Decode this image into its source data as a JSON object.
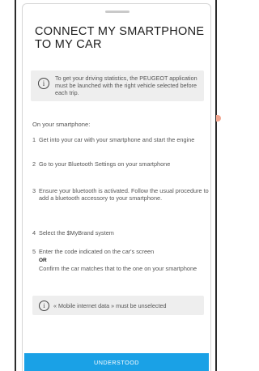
{
  "dialog": {
    "title": "CONNECT MY SMARTPHONE TO MY CAR",
    "info_text": "To get your driving statistics, the PEUGEOT application must be launched with the right vehicle selected before each trip.",
    "info_icon": "info-icon",
    "section_label": "On your smartphone:",
    "steps": [
      {
        "num": "1",
        "text": "Get into your car with your smartphone and start the engine"
      },
      {
        "num": "2",
        "text": "Go to your Bluetooth Settings on your smartphone"
      },
      {
        "num": "3",
        "text": "Ensure your bluetooth is activated. Follow the usual procedure to add a bluetooth accessory to your smartphone."
      },
      {
        "num": "4",
        "text": "Select the $MyBrand system"
      },
      {
        "num": "5",
        "text": "Enter the code indicated on the car's screen",
        "or_label": "OR",
        "alt_text": "Confirm the car matches that to the one on your smartphone"
      }
    ],
    "note_text": "« Mobile internet data » must be unselected",
    "button_label": "UNDERSTOOD"
  },
  "colors": {
    "accent": "#1aa1e6",
    "info_bg": "#eeeeee",
    "scroll_indicator": "#f2a58f"
  }
}
